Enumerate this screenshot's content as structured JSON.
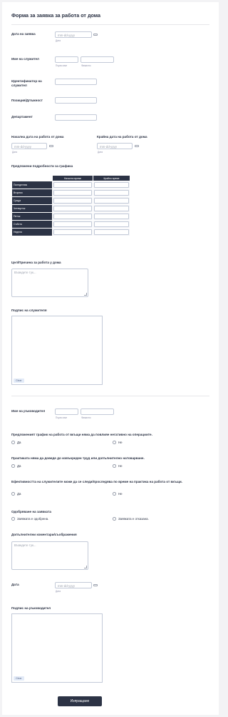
{
  "form": {
    "title": "Форма за заявка за работа от дома",
    "date_placeholder": "mm-dd-yyyy",
    "first_sub": "Първо име",
    "last_sub": "Фамилно",
    "date_sub": "Дата",
    "textarea_placeholder": "Въведете тук...",
    "clear_label": "Clear",
    "yes": "Да",
    "no": "Не",
    "submit_label": "Изпращане"
  },
  "request_date": {
    "label": "Дата на заявка"
  },
  "employee_name": {
    "label": "Име на служител"
  },
  "employee_id": {
    "label": "Идентификатор на служител"
  },
  "position": {
    "label": "Позиция/Длъжност"
  },
  "department": {
    "label": "Департамент"
  },
  "start_date": {
    "label": "Начална дата на работа от дома"
  },
  "end_date": {
    "label": "Крайна дата на работа от дома"
  },
  "schedule": {
    "label": "Предложени подробности за графика",
    "columns": [
      "Начално време",
      "Крайно време"
    ],
    "days": [
      "Понеделник",
      "Вторник",
      "Сряда",
      "Четвъртък",
      "Петък",
      "Събота",
      "Неделя"
    ]
  },
  "purpose": {
    "label": "Цел/Причина за работа у дома"
  },
  "employee_signature": {
    "label": "Подпис на служителя"
  },
  "manager_name": {
    "label": "Име на ръководител"
  },
  "q1": {
    "label": "Предложеният график на работа от вкъщи няма да повлияе негативно на операциите."
  },
  "q2": {
    "label": "Практиката няма да доведе до извънреден труд или допълнително натоварване."
  },
  "q3": {
    "label": "Ефективността на служителите може да се следи/проследява по време на практика на работа от вкъщи."
  },
  "approval": {
    "label": "Одобряване на заявката",
    "approved": "Заявката е одобрена.",
    "rejected": "Заявката е отказана."
  },
  "comments": {
    "label": "Допълнителни коментари/съображения"
  },
  "manager_date": {
    "label": "Дата"
  },
  "manager_signature": {
    "label": "Подпис на ръководител"
  }
}
